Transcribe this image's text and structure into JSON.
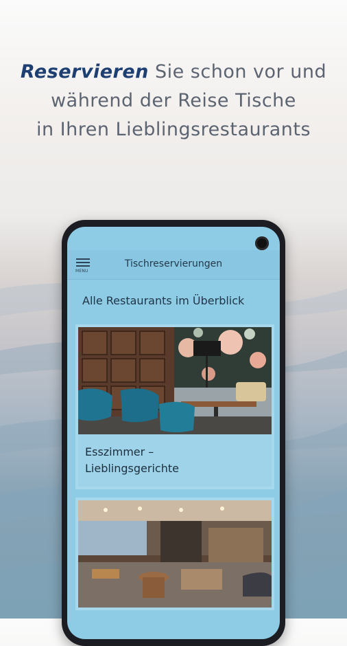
{
  "headline": {
    "emphasis": "Reservieren",
    "line1_rest": " Sie schon vor und",
    "line2": "während der Reise Tische",
    "line3": "in Ihren Lieblingsrestaurants"
  },
  "app": {
    "menu_label": "MENU",
    "title": "Tischreservierungen",
    "section_title": "Alle Restaurants im Überblick",
    "restaurants": [
      {
        "name": "Esszimmer –\nLieblingsgerichte"
      },
      {
        "name": ""
      }
    ]
  },
  "colors": {
    "accent": "#1e3f72",
    "screen_bg": "#8ecbe5",
    "card_bg": "#a7d8ec"
  }
}
